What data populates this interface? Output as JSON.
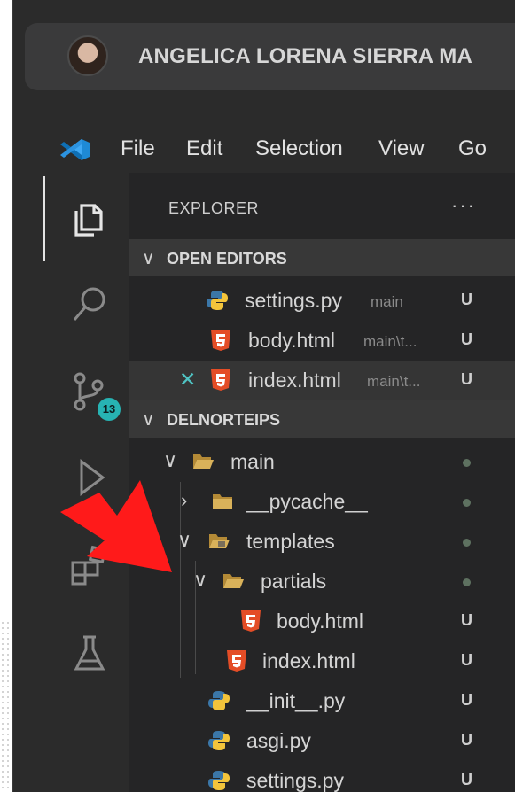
{
  "title_bar": {
    "user_name": "ANGELICA LORENA SIERRA MA"
  },
  "menu": {
    "items": [
      "File",
      "Edit",
      "Selection",
      "View",
      "Go"
    ]
  },
  "activity_bar": {
    "source_control_badge": "13"
  },
  "explorer": {
    "title": "EXPLORER",
    "more": "···",
    "open_editors": {
      "header": "OPEN EDITORS",
      "items": [
        {
          "name": "settings.py",
          "desc": "main",
          "status": "U",
          "icon": "python-icon"
        },
        {
          "name": "body.html",
          "desc": "main\\t...",
          "status": "U",
          "icon": "html5-icon"
        },
        {
          "name": "index.html",
          "desc": "main\\t...",
          "status": "U",
          "icon": "html5-icon",
          "close": "✕"
        }
      ]
    },
    "project": {
      "header": "DELNORTEIPS",
      "tree": [
        {
          "name": "main",
          "type": "folder",
          "expanded": true
        },
        {
          "name": "__pycache__",
          "type": "folder",
          "expanded": false
        },
        {
          "name": "templates",
          "type": "folder",
          "expanded": true
        },
        {
          "name": "partials",
          "type": "folder",
          "expanded": true
        },
        {
          "name": "body.html",
          "type": "html",
          "status": "U"
        },
        {
          "name": "index.html",
          "type": "html",
          "status": "U"
        },
        {
          "name": "__init__.py",
          "type": "python",
          "status": "U"
        },
        {
          "name": "asgi.py",
          "type": "python",
          "status": "U"
        },
        {
          "name": "settings.py",
          "type": "python",
          "status": "U"
        }
      ]
    }
  },
  "colors": {
    "accent_badge": "#27b3b3",
    "html_icon": "#e44d26",
    "python_blue": "#3b77a8",
    "python_yellow": "#f2c43b",
    "folder": "#cfa94f",
    "arrow": "#ff1a1a"
  }
}
